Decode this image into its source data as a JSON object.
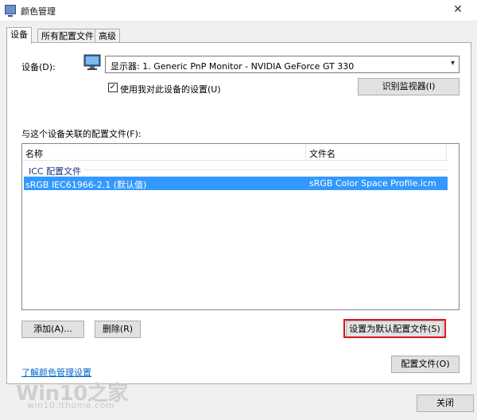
{
  "window": {
    "title": "颜色管理",
    "close_glyph": "✕",
    "app_icon": "color-management-icon"
  },
  "tabs": [
    {
      "label": "设备",
      "active": true
    },
    {
      "label": "所有配置文件",
      "active": false
    },
    {
      "label": "高级",
      "active": false
    }
  ],
  "device": {
    "label": "设备(D):",
    "monitor_icon": "monitor-icon",
    "selected": "显示器: 1. Generic PnP Monitor - NVIDIA GeForce GT 330",
    "use_my_settings_label": "使用我对此设备的设置(U)",
    "use_my_settings_checked": true,
    "identify_button": "识别监视器(I)"
  },
  "profiles": {
    "section_label": "与这个设备关联的配置文件(F):",
    "columns": [
      "名称",
      "文件名"
    ],
    "group_label": "ICC 配置文件",
    "rows": [
      {
        "name": "sRGB IEC61966-2.1 (默认值)",
        "file": "sRGB Color Space Profile.icm",
        "selected": true
      }
    ]
  },
  "buttons": {
    "add": "添加(A)...",
    "remove": "删除(R)",
    "set_default": "设置为默认配置文件(S)",
    "profiles": "配置文件(O)",
    "close": "关闭"
  },
  "link": {
    "learn_more": "了解颜色管理设置"
  },
  "watermark": {
    "main": "Win10之家",
    "sub": "win10.ithome.com"
  },
  "colors": {
    "selection": "#3399ff",
    "link": "#0066cc",
    "highlight_frame": "#d9141c",
    "group_label": "#1e3287"
  }
}
